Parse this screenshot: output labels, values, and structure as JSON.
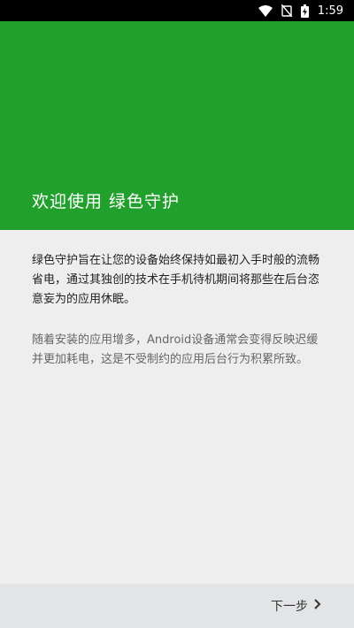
{
  "status_bar": {
    "time": "1:59",
    "icons": [
      "wifi-icon",
      "silent-icon",
      "battery-icon"
    ]
  },
  "header": {
    "title": "欢迎使用 绿色守护",
    "background_color": "#22a02e"
  },
  "content": {
    "paragraph_1": "绿色守护旨在让您的设备始终保持如最初入手时般的流畅省电，通过其独创的技术在手机待机期间将那些在后台恣意妄为的应用休眠。",
    "paragraph_2": "随着安装的应用增多，Android设备通常会变得反映迟缓并更加耗电，这是不受制约的应用后台行为积累所致。"
  },
  "footer": {
    "next_label": "下一步",
    "next_icon": "chevron-right-icon"
  }
}
